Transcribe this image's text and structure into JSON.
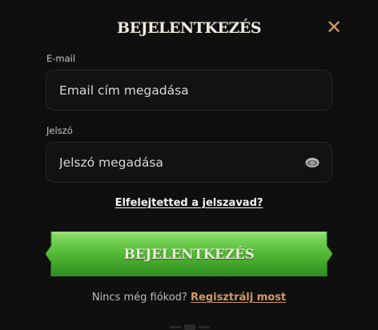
{
  "modal": {
    "title": "BEJELENTKEZÉS",
    "close_icon": "close-icon"
  },
  "email": {
    "label": "E-mail",
    "placeholder": "Email cím megadása",
    "value": ""
  },
  "password": {
    "label": "Jelszó",
    "placeholder": "Jelszó megadása",
    "value": "",
    "toggle_icon": "eye-icon"
  },
  "forgot_password": "Elfelejtetted a jelszavad?",
  "login_button": "BEJELENTKEZÉS",
  "register": {
    "prompt": "Nincs még fiókod?",
    "link": "Regisztrálj most"
  },
  "colors": {
    "background": "#0f0f10",
    "accent": "#d39a61",
    "button_green": "#5cc23f",
    "field_border": "#26272a"
  }
}
